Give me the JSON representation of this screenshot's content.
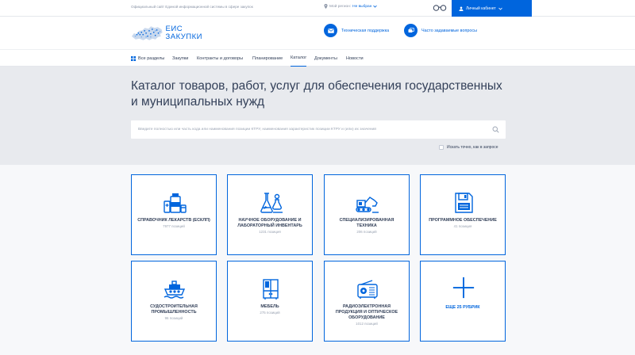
{
  "topbar": {
    "official_text": "Официальный сайт Единой информационной системы в сфере закупок",
    "region_label": "Мой регион:",
    "region_value": "Не выбран",
    "account_label": "Личный кабинет",
    "icons": {
      "location": "pin-icon",
      "vision": "glasses-icon",
      "account": "user-icon"
    }
  },
  "header": {
    "logo_line1": "ЕИС",
    "logo_line2": "ЗАКУПКИ",
    "support_label": "Техническая поддержка",
    "faq_label": "Часто задаваемые вопросы"
  },
  "nav": {
    "items": [
      {
        "label": "Все разделы"
      },
      {
        "label": "Закупки"
      },
      {
        "label": "Контракты и договоры"
      },
      {
        "label": "Планирование"
      },
      {
        "label": "Каталог",
        "active": true
      },
      {
        "label": "Документы"
      },
      {
        "label": "Новости"
      }
    ]
  },
  "hero": {
    "title": "Каталог товаров, работ, услуг для обеспечения государственных и муниципальных нужд",
    "search_placeholder": "Введите полностью или часть кода или наименования позиции КТРУ, наименования характеристик позиции КТРУ и (или) их значений",
    "exact_label": "Искать точно, как в запросе"
  },
  "cards": [
    {
      "title": "Справочник лекарств (ЕСКЛП)",
      "count": "7977 позиций",
      "icon": "medicine-icon"
    },
    {
      "title": "Научное оборудование и лабораторный инвентарь",
      "count": "1231 позиция",
      "icon": "lab-flask-icon"
    },
    {
      "title": "Специализированная техника",
      "count": "206 позиций",
      "icon": "excavator-icon"
    },
    {
      "title": "Программное обеспечение",
      "count": "41 позиция",
      "icon": "floppy-disk-icon"
    },
    {
      "title": "Судостроительная промышленность",
      "count": "96 позиций",
      "icon": "ship-icon"
    },
    {
      "title": "Мебель",
      "count": "275 позиций",
      "icon": "furniture-icon"
    },
    {
      "title": "Радиоэлектронная продукция и оптическое оборудование",
      "count": "1012 позиций",
      "icon": "radio-icon"
    },
    {
      "title": "Еще 25 рубрик",
      "count": "",
      "icon": "plus-icon"
    }
  ],
  "colors": {
    "accent": "#0065dd",
    "text": "#334059",
    "hero_bg": "#e8eaee"
  }
}
